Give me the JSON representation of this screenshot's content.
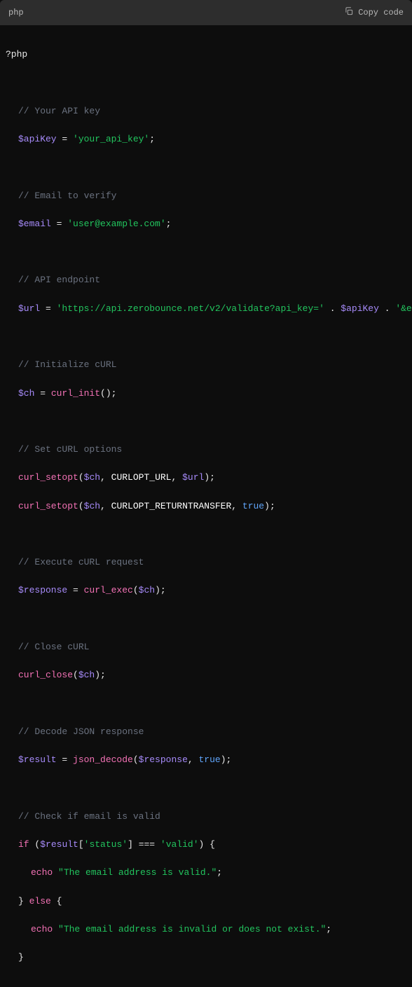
{
  "header": {
    "language": "php",
    "copy_label": "Copy code"
  },
  "code": {
    "php_open": "?php",
    "c1": "// Your API key",
    "v_apikey": "$apiKey",
    "eq": " = ",
    "s_apikey": "'your_api_key'",
    "semi": ";",
    "c2": "// Email to verify",
    "v_email": "$email",
    "s_email": "'user@example.com'",
    "c3": "// API endpoint",
    "v_url": "$url",
    "s_url1": "'https://api.zerobounce.net/v2/validate?api_key='",
    "dot": " . ",
    "s_url2": "'&email='",
    "c4": "// Initialize cURL",
    "v_ch": "$ch",
    "f_curl_init": "curl_init",
    "paren_open": "(",
    "paren_close": ")",
    "c5": "// Set cURL options",
    "f_curl_setopt": "curl_setopt",
    "comma": ", ",
    "const_url": "CURLOPT_URL",
    "const_rt": "CURLOPT_RETURNTRANSFER",
    "true": "true",
    "c6": "// Execute cURL request",
    "v_response": "$response",
    "f_curl_exec": "curl_exec",
    "c7": "// Close cURL",
    "f_curl_close": "curl_close",
    "c8": "// Decode JSON response",
    "v_result": "$result",
    "f_json_decode": "json_decode",
    "c9": "// Check if email is valid",
    "kw_if": "if",
    "bracket_open": "[",
    "s_status": "'status'",
    "bracket_close": "]",
    "tripleeq": " === ",
    "s_valid": "'valid'",
    "brace_open": " {",
    "brace_close": "}",
    "kw_echo": "echo",
    "s_msg_valid": "\"The email address is valid.\"",
    "kw_else": " else ",
    "s_msg_invalid": "\"The email address is invalid or does not exist.\""
  }
}
